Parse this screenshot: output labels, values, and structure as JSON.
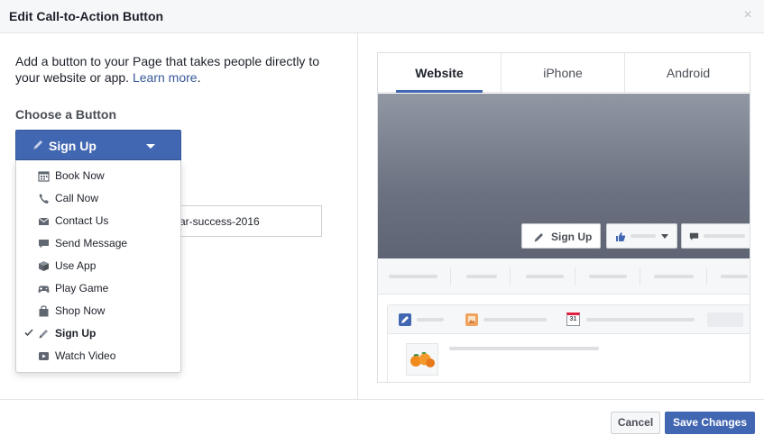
{
  "dialog": {
    "title": "Edit Call-to-Action Button",
    "close_glyph": "×"
  },
  "intro": {
    "text": "Add a button to your Page that takes people directly to your website or app. ",
    "link": "Learn more",
    "trailing": "."
  },
  "choose": {
    "label": "Choose a Button",
    "selected": "Sign Up",
    "options": [
      {
        "label": "Book Now",
        "icon": "calendar-icon",
        "selected": false
      },
      {
        "label": "Call Now",
        "icon": "phone-icon",
        "selected": false
      },
      {
        "label": "Contact Us",
        "icon": "envelope-icon",
        "selected": false
      },
      {
        "label": "Send Message",
        "icon": "chat-bubble-icon",
        "selected": false
      },
      {
        "label": "Use App",
        "icon": "box-icon",
        "selected": false
      },
      {
        "label": "Play Game",
        "icon": "gamepad-icon",
        "selected": false
      },
      {
        "label": "Shop Now",
        "icon": "shopping-bag-icon",
        "selected": false
      },
      {
        "label": "Sign Up",
        "icon": "pencil-icon",
        "selected": true
      },
      {
        "label": "Watch Video",
        "icon": "play-icon",
        "selected": false
      }
    ]
  },
  "url_field": {
    "visible_value": "ar-success-2016"
  },
  "preview": {
    "tabs": [
      {
        "label": "Website",
        "active": true
      },
      {
        "label": "iPhone",
        "active": false
      },
      {
        "label": "Android",
        "active": false
      }
    ],
    "cta_label": "Sign Up",
    "calendar_day": "31"
  },
  "footer": {
    "cancel": "Cancel",
    "save": "Save Changes"
  },
  "colors": {
    "primary": "#4267b2",
    "link": "#365899",
    "header_bg": "#f6f7f9",
    "border": "#dddfe2"
  }
}
